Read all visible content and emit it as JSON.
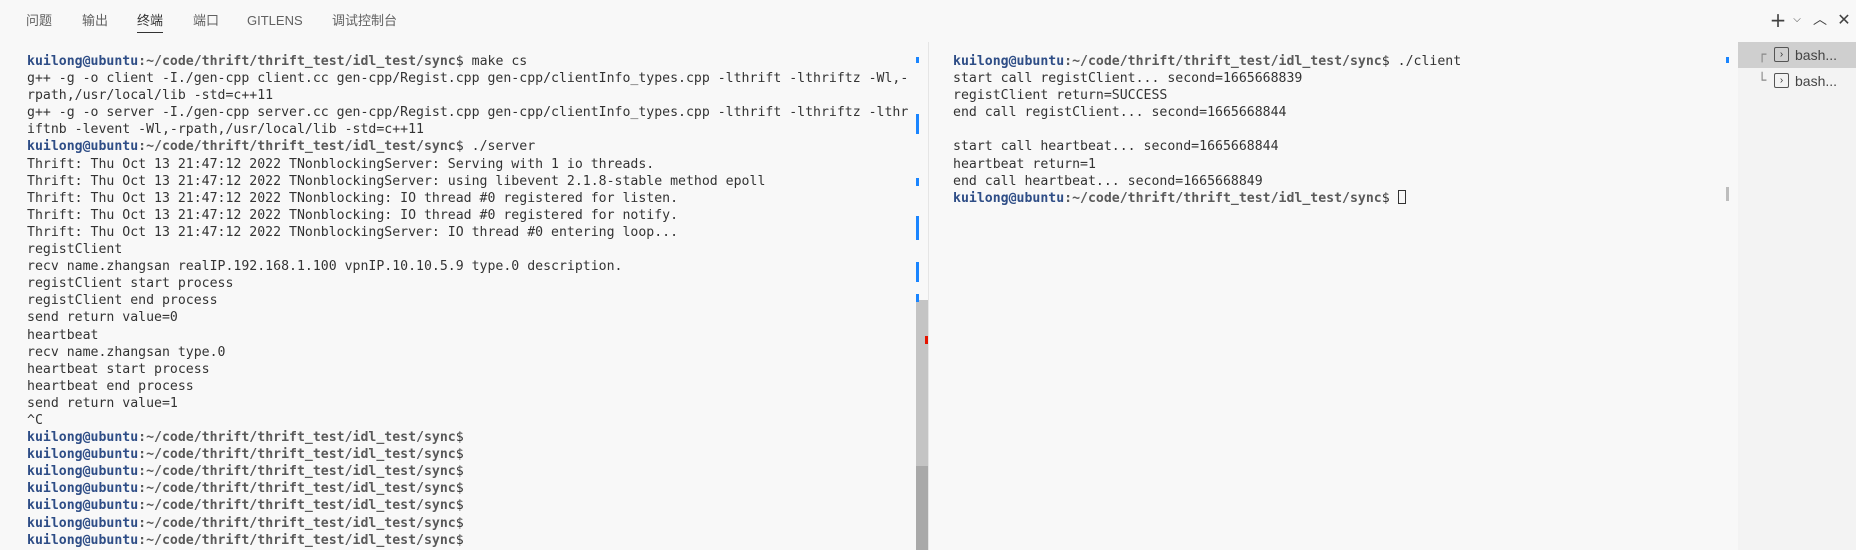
{
  "panel_tabs": [
    {
      "label": "问题",
      "active": false
    },
    {
      "label": "输出",
      "active": false
    },
    {
      "label": "终端",
      "active": true
    },
    {
      "label": "端口",
      "active": false
    },
    {
      "label": "GITLENS",
      "active": false
    },
    {
      "label": "调试控制台",
      "active": false
    }
  ],
  "toolbar": {
    "icons": [
      "plus-icon",
      "chevron-down-icon",
      "chevron-up-icon",
      "close-icon"
    ]
  },
  "prompt": {
    "user": "kuilong@ubuntu",
    "path": ":~/code/thrift/thrift_test/idl_test/sync",
    "symbol": "$"
  },
  "left_terminal": {
    "lines": [
      {
        "type": "prompt",
        "marker": "blue",
        "cmd": " make cs"
      },
      {
        "type": "text",
        "text": "g++ -g -o client -I./gen-cpp client.cc gen-cpp/Regist.cpp gen-cpp/clientInfo_types.cpp -lthrift -lthriftz -Wl,-"
      },
      {
        "type": "text",
        "text": "rpath,/usr/local/lib -std=c++11"
      },
      {
        "type": "text",
        "text": "g++ -g -o server -I./gen-cpp server.cc gen-cpp/Regist.cpp gen-cpp/clientInfo_types.cpp -lthrift -lthriftz -lthr"
      },
      {
        "type": "text",
        "text": "iftnb -levent -Wl,-rpath,/usr/local/lib -std=c++11"
      },
      {
        "type": "prompt",
        "marker": "error",
        "cmd": " ./server"
      },
      {
        "type": "text",
        "text": "Thrift: Thu Oct 13 21:47:12 2022 TNonblockingServer: Serving with 1 io threads."
      },
      {
        "type": "text",
        "text": "Thrift: Thu Oct 13 21:47:12 2022 TNonblockingServer: using libevent 2.1.8-stable method epoll"
      },
      {
        "type": "text",
        "text": "Thrift: Thu Oct 13 21:47:12 2022 TNonblocking: IO thread #0 registered for listen."
      },
      {
        "type": "text",
        "text": "Thrift: Thu Oct 13 21:47:12 2022 TNonblocking: IO thread #0 registered for notify."
      },
      {
        "type": "text",
        "text": "Thrift: Thu Oct 13 21:47:12 2022 TNonblockingServer: IO thread #0 entering loop..."
      },
      {
        "type": "text",
        "text": "registClient"
      },
      {
        "type": "text",
        "text": "recv name.zhangsan realIP.192.168.1.100 vpnIP.10.10.5.9 type.0 description."
      },
      {
        "type": "text",
        "text": "registClient start process"
      },
      {
        "type": "text",
        "text": "registClient end process"
      },
      {
        "type": "text",
        "text": "send return value=0"
      },
      {
        "type": "text",
        "text": "heartbeat"
      },
      {
        "type": "text",
        "text": "recv name.zhangsan type.0"
      },
      {
        "type": "text",
        "text": "heartbeat start process"
      },
      {
        "type": "text",
        "text": "heartbeat end process"
      },
      {
        "type": "text",
        "text": "send return value=1"
      },
      {
        "type": "text",
        "text": "^C"
      },
      {
        "type": "prompt",
        "marker": "hollow",
        "cmd": ""
      },
      {
        "type": "prompt",
        "marker": "hollow",
        "cmd": ""
      },
      {
        "type": "prompt",
        "marker": "hollow",
        "cmd": ""
      },
      {
        "type": "prompt",
        "marker": "hollow",
        "cmd": ""
      },
      {
        "type": "prompt",
        "marker": "hollow",
        "cmd": ""
      },
      {
        "type": "prompt",
        "marker": "hollow",
        "cmd": ""
      },
      {
        "type": "prompt",
        "marker": "hollow",
        "cmd": ""
      }
    ]
  },
  "right_terminal": {
    "lines": [
      {
        "type": "prompt",
        "marker": "blue",
        "cmd": " ./client"
      },
      {
        "type": "text",
        "text": "start call registClient... second=1665668839"
      },
      {
        "type": "text",
        "text": "registClient return=SUCCESS"
      },
      {
        "type": "text",
        "text": "end call registClient... second=1665668844"
      },
      {
        "type": "text",
        "text": ""
      },
      {
        "type": "text",
        "text": "start call heartbeat... second=1665668844"
      },
      {
        "type": "text",
        "text": "heartbeat return=1"
      },
      {
        "type": "text",
        "text": "end call heartbeat... second=1665668849"
      },
      {
        "type": "prompt",
        "marker": "hollow",
        "cmd": " ",
        "cursor": true
      }
    ]
  },
  "terminal_list": [
    {
      "label": "bash...",
      "icon": "terminal-icon",
      "tree": "┌",
      "active": true
    },
    {
      "label": "bash...",
      "icon": "terminal-icon",
      "tree": "└",
      "active": false
    }
  ],
  "colors": {
    "prompt_user": "#2e4d86",
    "marker_blue": "#1a85ff",
    "marker_error": "#e51400"
  }
}
